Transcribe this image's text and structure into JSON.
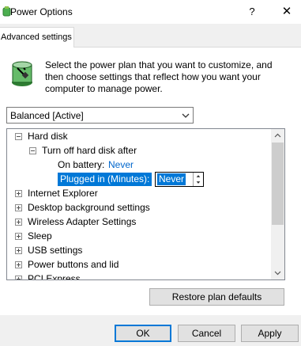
{
  "window": {
    "title": "Power Options",
    "help_label": "?",
    "close_label": "✕"
  },
  "tab": {
    "label": "Advanced settings"
  },
  "intro": {
    "text": "Select the power plan that you want to customize, and then choose settings that reflect how you want your computer to manage power."
  },
  "plan_select": {
    "value": "Balanced [Active]"
  },
  "tree": {
    "hard_disk": {
      "label": "Hard disk"
    },
    "turn_off": {
      "label": "Turn off hard disk after"
    },
    "on_battery": {
      "label": "On battery:",
      "value": "Never"
    },
    "plugged_in": {
      "label": "Plugged in (Minutes):",
      "value": "Never"
    },
    "items": [
      {
        "label": "Internet Explorer"
      },
      {
        "label": "Desktop background settings"
      },
      {
        "label": "Wireless Adapter Settings"
      },
      {
        "label": "Sleep"
      },
      {
        "label": "USB settings"
      },
      {
        "label": "Power buttons and lid"
      },
      {
        "label": "PCI Express"
      }
    ]
  },
  "buttons": {
    "restore": "Restore plan defaults",
    "ok": "OK",
    "cancel": "Cancel",
    "apply": "Apply"
  },
  "colors": {
    "accent": "#0078d7",
    "link": "#0066cc"
  }
}
